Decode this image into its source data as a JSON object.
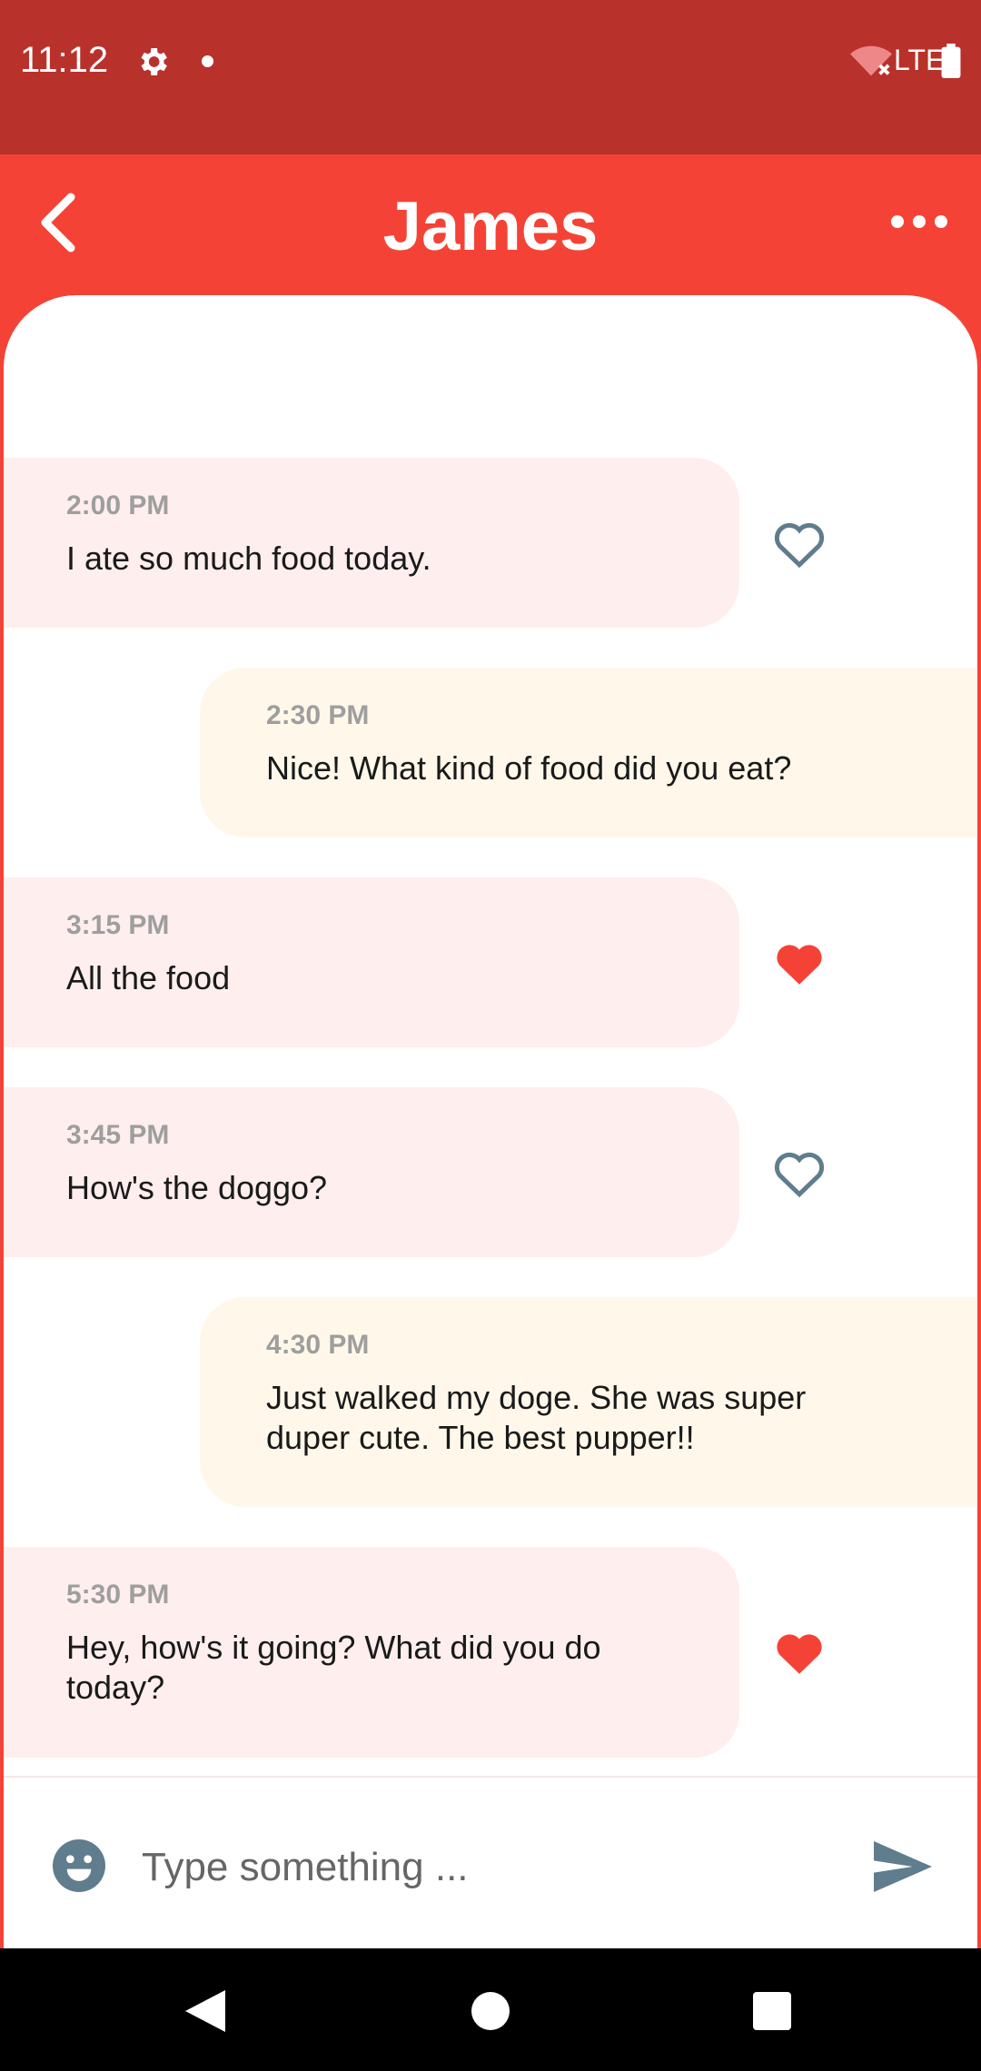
{
  "status_bar": {
    "time": "11:12",
    "network": "LTE",
    "icons": [
      "gear-icon",
      "notification-dot-icon",
      "wifi-off-icon",
      "battery-icon"
    ]
  },
  "app_bar": {
    "title": "James",
    "back_icon": "chevron-left-icon",
    "more_icon": "more-horizontal-icon"
  },
  "messages": [
    {
      "time": "2:00 PM",
      "text": "I ate so much food today.",
      "direction": "incoming",
      "liked": false
    },
    {
      "time": "2:30 PM",
      "text": "Nice! What kind of food did you eat?",
      "direction": "outgoing"
    },
    {
      "time": "3:15 PM",
      "text": "All the food",
      "direction": "incoming",
      "liked": true
    },
    {
      "time": "3:45 PM",
      "text": "How's the doggo?",
      "direction": "incoming",
      "liked": false
    },
    {
      "time": "4:30 PM",
      "text": "Just walked my doge. She was super duper cute. The best pupper!!",
      "direction": "outgoing"
    },
    {
      "time": "5:30 PM",
      "text": "Hey, how's it going? What did you do today?",
      "direction": "incoming",
      "liked": true
    }
  ],
  "composer": {
    "placeholder": "Type something ...",
    "emoji_icon": "emoji-smile-icon",
    "send_icon": "send-icon"
  },
  "colors": {
    "status_bar": "#b8322b",
    "app_bar": "#f44336",
    "incoming_bubble": "#ffeeee",
    "outgoing_bubble": "#fff8ea",
    "heart_liked": "#f44336",
    "icon_gray": "#5f7d8c"
  }
}
